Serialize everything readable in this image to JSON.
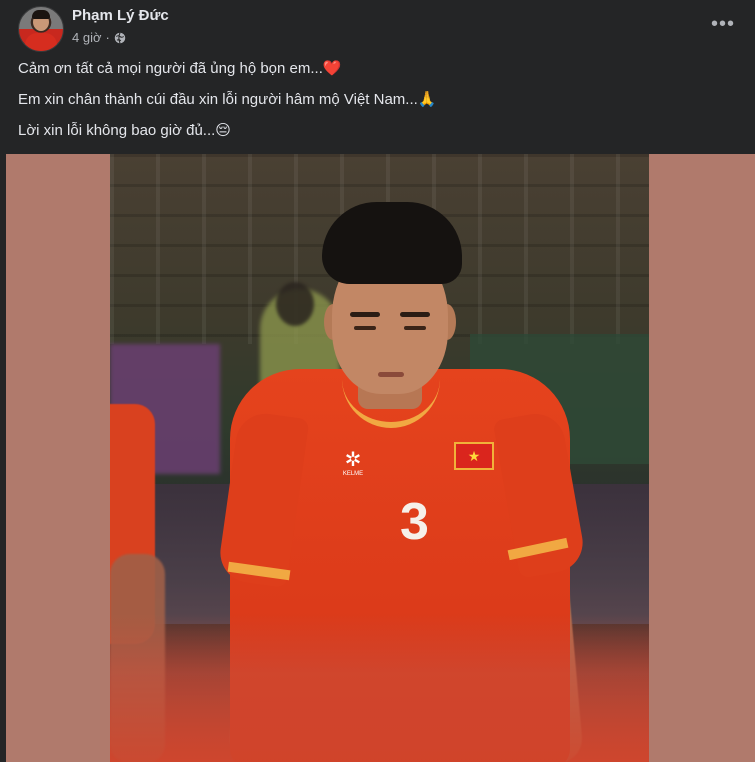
{
  "post": {
    "author_name": "Phạm Lý Đức",
    "timestamp": "4 giờ",
    "separator": "·",
    "privacy_icon": "globe-icon",
    "more_icon": "more-horizontal-icon",
    "more_label": "•••",
    "caption_lines": [
      "Cảm ơn tất cả mọi người đã ủng hộ bọn em...❤️",
      "Em xin chân thành cúi đầu xin lỗi người hâm mộ Việt Nam...🙏",
      "Lời xin lỗi không bao giờ đủ...😔"
    ],
    "photo": {
      "jersey_number": "3",
      "flag_star": "★",
      "badge_glyph": "✲",
      "badge_text": "KELME"
    }
  },
  "colors": {
    "background": "#242526",
    "text_primary": "#e4e6eb",
    "text_secondary": "#b0b3b8",
    "photo_frame": "#b07a6c",
    "jersey_red": "#e5431d",
    "jersey_trim": "#f1a842"
  }
}
